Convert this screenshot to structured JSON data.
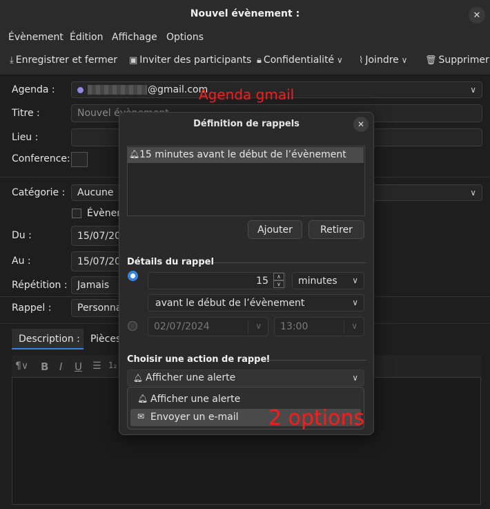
{
  "window": {
    "title": "Nouvel évènement :"
  },
  "menu": {
    "items": [
      "Évènement",
      "Édition",
      "Affichage",
      "Options"
    ]
  },
  "toolbar": {
    "save_close": "Enregistrer et fermer",
    "invite": "Inviter des participants",
    "privacy": "Confidentialité",
    "attach": "Joindre",
    "delete": "Supprimer"
  },
  "form": {
    "agenda_label": "Agenda :",
    "agenda_value": "@gmail.com",
    "title_label": "Titre :",
    "title_placeholder": "Nouvel évènement",
    "location_label": "Lieu :",
    "conference_label": "Conference:",
    "category_label": "Catégorie :",
    "category_value": "Aucune",
    "allday_label": "Évènement",
    "from_label": "Du :",
    "from_value": "15/07/2024",
    "to_label": "Au :",
    "to_value": "15/07/2024",
    "repeat_label": "Répétition :",
    "repeat_value": "Jamais",
    "reminder_label": "Rappel :",
    "reminder_value": "Personnalisé"
  },
  "tabs": {
    "description": "Description :",
    "attachments": "Pièces jointes"
  },
  "annotations": {
    "agenda": "Agenda gmail",
    "options": "2 options"
  },
  "dialog": {
    "title": "Définition de rappels",
    "reminders": [
      "15 minutes avant le début de l’évènement"
    ],
    "add_button": "Ajouter",
    "remove_button": "Retirer",
    "details_title": "Détails du rappel",
    "amount": "15",
    "unit": "minutes",
    "relation": "avant le début de l’évènement",
    "abs_date": "02/07/2024",
    "abs_time": "13:00",
    "action_title": "Choisir une action de rappel",
    "action_selected": "Afficher une alerte",
    "action_options": [
      "Afficher une alerte",
      "Envoyer un e-mail"
    ]
  },
  "colors": {
    "accent": "#3584e4",
    "annotation": "#ff1a1a",
    "calendar_dot": "#8a8ae0"
  }
}
